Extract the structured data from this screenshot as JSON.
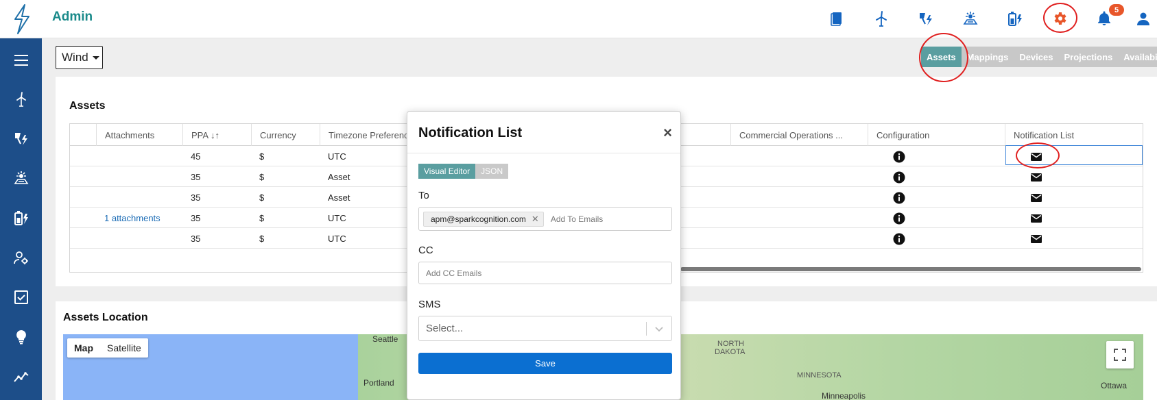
{
  "app": {
    "title": "Admin"
  },
  "header": {
    "notification_count": "5"
  },
  "asset_type": {
    "selected": "Wind"
  },
  "tabs": [
    {
      "label": "Assets",
      "active": true
    },
    {
      "label": "Mappings",
      "active": false
    },
    {
      "label": "Devices",
      "active": false
    },
    {
      "label": "Projections",
      "active": false
    },
    {
      "label": "Availability",
      "active": false
    }
  ],
  "assets": {
    "title": "Assets",
    "columns": [
      "Attachments",
      "PPA ↓↑",
      "Currency",
      "Timezone Preference",
      "Commercial Operations ...",
      "Configuration",
      "Notification List"
    ],
    "rows": [
      {
        "attachments": "",
        "ppa": "45",
        "currency": "$",
        "timezone": "UTC"
      },
      {
        "attachments": "",
        "ppa": "35",
        "currency": "$",
        "timezone": "Asset"
      },
      {
        "attachments": "",
        "ppa": "35",
        "currency": "$",
        "timezone": "Asset"
      },
      {
        "attachments": "1 attachments",
        "ppa": "35",
        "currency": "$",
        "timezone": "UTC"
      },
      {
        "attachments": "",
        "ppa": "35",
        "currency": "$",
        "timezone": "UTC"
      }
    ]
  },
  "location": {
    "title": "Assets Location",
    "map_types": [
      "Map",
      "Satellite"
    ],
    "labels": [
      "Seattle",
      "Portland",
      "NORTH",
      "DAKOTA",
      "MINNESOTA",
      "Minneapolis",
      "Ottawa"
    ]
  },
  "modal": {
    "title": "Notification List",
    "close": "×",
    "modes": [
      "Visual Editor",
      "JSON"
    ],
    "to_label": "To",
    "to_chips": [
      "apm@sparkcognition.com"
    ],
    "to_placeholder": "Add To Emails",
    "cc_label": "CC",
    "cc_placeholder": "Add CC Emails",
    "sms_label": "SMS",
    "sms_placeholder": "Select...",
    "save_label": "Save"
  },
  "colors": {
    "brand": "#1a8a8a",
    "sidebar": "#1d4e89",
    "icon_blue": "#1565c0",
    "accent_orange": "#e8562a",
    "tab_active": "#5a9ea0",
    "save": "#0b6fd1"
  }
}
